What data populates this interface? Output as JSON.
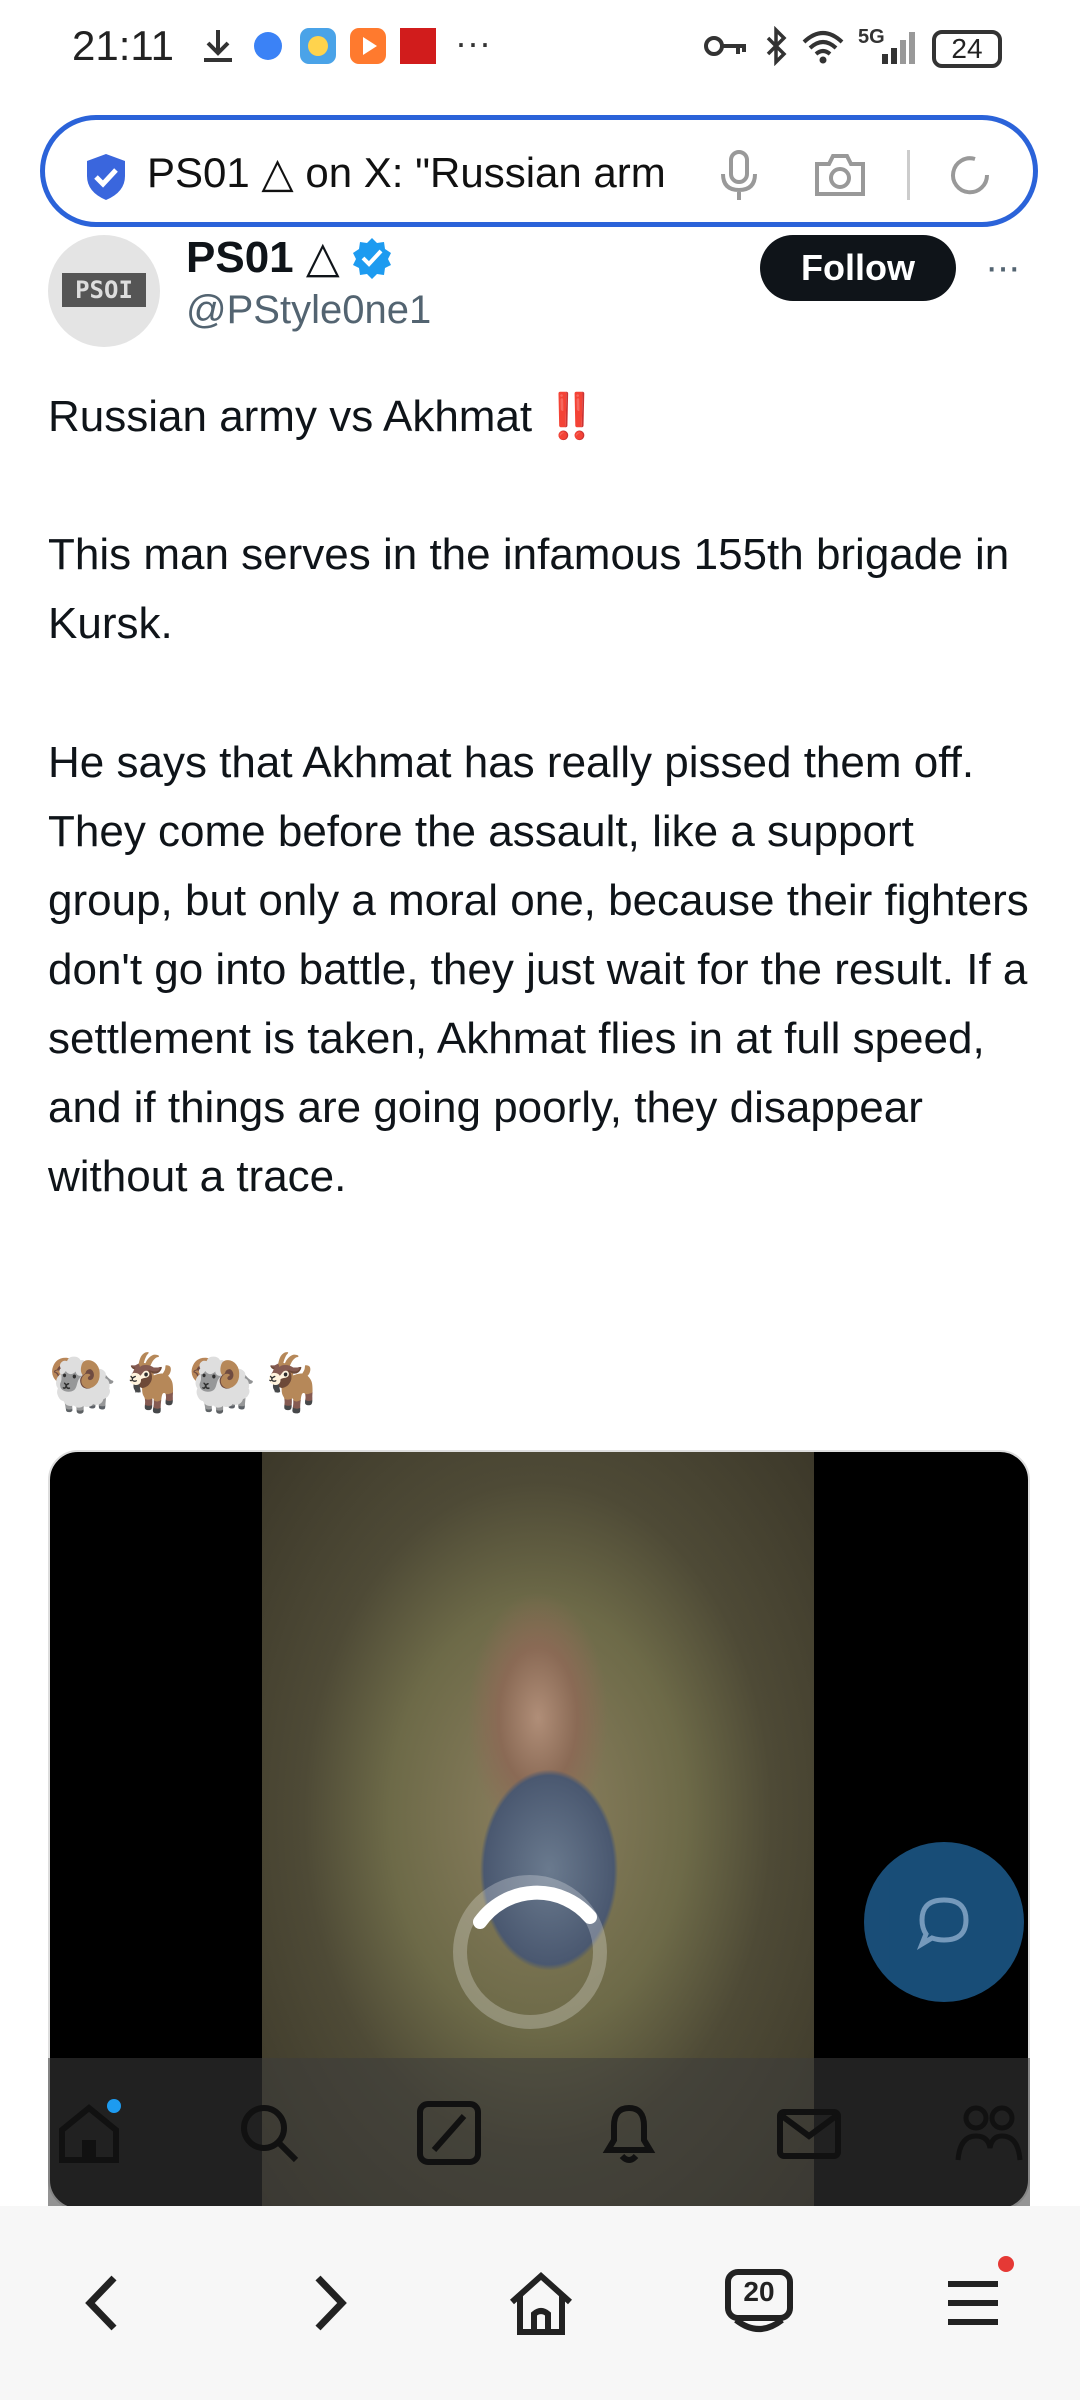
{
  "status_bar": {
    "time": "21:11",
    "notification_dots": "···",
    "network": "5G",
    "battery": "24"
  },
  "url_bar": {
    "text": "PS01 △ on X: \"Russian arm"
  },
  "tweet": {
    "display_name": "PS01 △",
    "handle": "@PStyle0ne1",
    "avatar_text": "PSOI",
    "follow_label": "Follow",
    "more_label": "···",
    "line1": "Russian army vs Akhmat ‼️",
    "paragraph2": "This man serves in the infamous 155th brigade in Kursk.",
    "paragraph3": "He says that Akhmat has really pissed them off. They come before the assault, like a support group, but only a moral one, because their fighters don't go into battle, they just wait for the result. If a settlement is taken, Akhmat flies in at full speed, and if things are going poorly, they disappear without a trace.",
    "emojis": "🐏🐐🐏🐐"
  },
  "tabbar": {
    "items": [
      "home-icon",
      "search-icon",
      "grok-icon",
      "notifications-icon",
      "messages-icon",
      "communities-icon"
    ]
  },
  "browser_nav": {
    "tabs_count": "20"
  },
  "colors": {
    "accent": "#2b63d9",
    "verified": "#1d9bf0",
    "text": "#0f1419",
    "secondary": "#536471",
    "fab": "#1d5b8c"
  }
}
